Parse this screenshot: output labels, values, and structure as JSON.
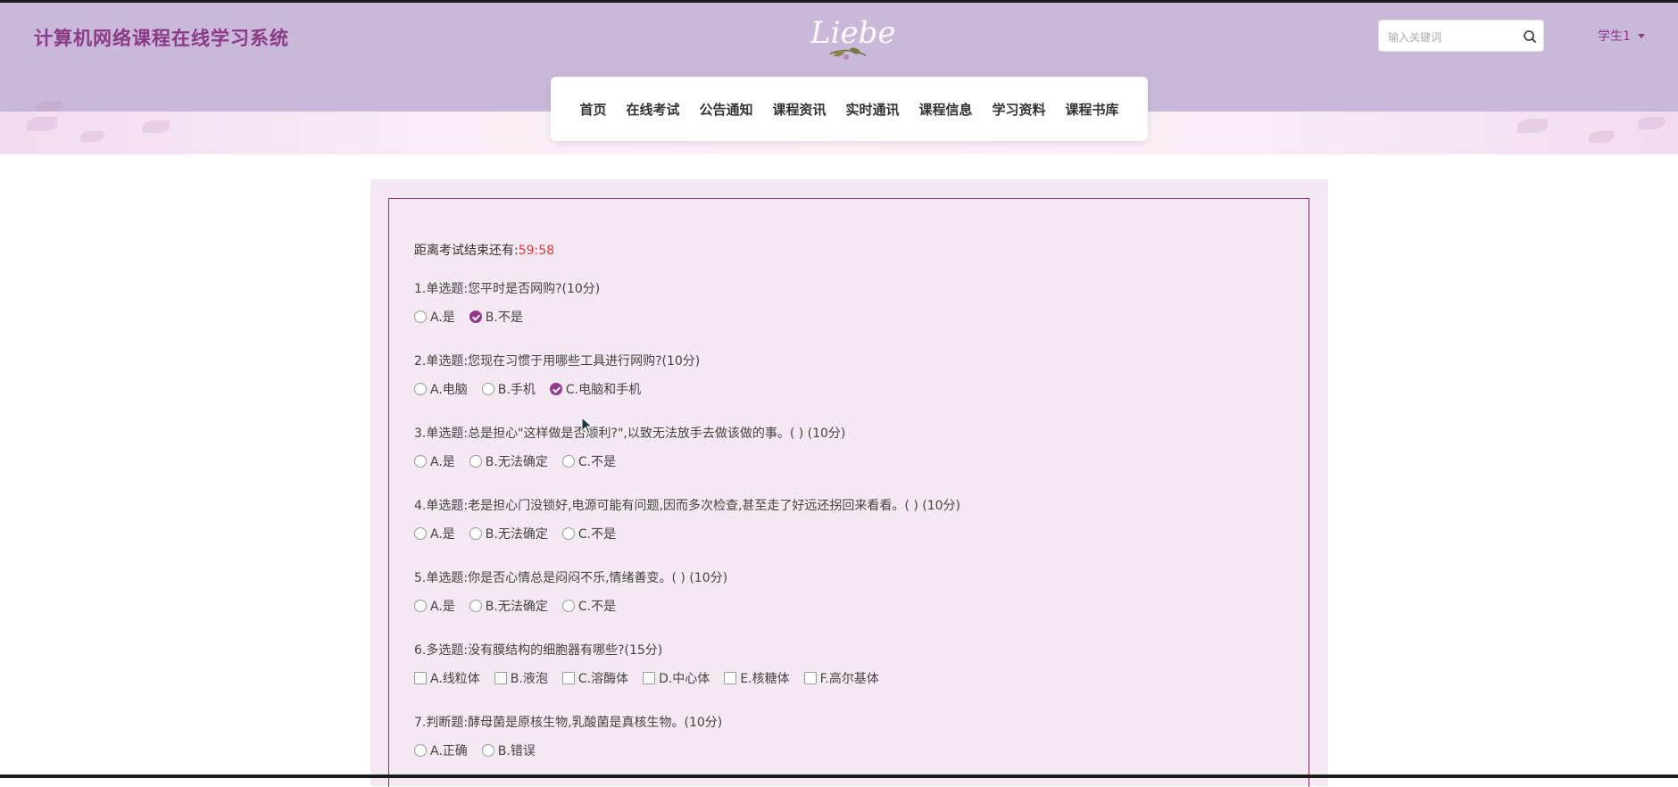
{
  "header": {
    "site_title": "计算机网络课程在线学习系统",
    "logo_text": "Liebe",
    "search_placeholder": "输入关键词",
    "user_label": "学生1",
    "accent_color": "#8a3a86",
    "header_bg": "#c9b8d9"
  },
  "nav": {
    "items": [
      "首页",
      "在线考试",
      "公告通知",
      "课程资讯",
      "实时通讯",
      "课程信息",
      "学习资料",
      "课程书库"
    ]
  },
  "exam": {
    "timer_label": "距离考试结束还有:",
    "timer_value": "59:58",
    "questions": [
      {
        "title": "1.单选题:您平时是否网购?(10分)",
        "type": "radio",
        "options": [
          {
            "label": "A.是",
            "checked": false
          },
          {
            "label": "B.不是",
            "checked": true
          }
        ]
      },
      {
        "title": "2.单选题:您现在习惯于用哪些工具进行网购?(10分)",
        "type": "radio",
        "options": [
          {
            "label": "A.电脑",
            "checked": false
          },
          {
            "label": "B.手机",
            "checked": false
          },
          {
            "label": "C.电脑和手机",
            "checked": true
          }
        ]
      },
      {
        "title": "3.单选题:总是担心\"这样做是否顺利?\",以致无法放手去做该做的事。( ) (10分)",
        "type": "radio",
        "options": [
          {
            "label": "A.是",
            "checked": false
          },
          {
            "label": "B.无法确定",
            "checked": false
          },
          {
            "label": "C.不是",
            "checked": false
          }
        ]
      },
      {
        "title": "4.单选题:老是担心门没锁好,电源可能有问题,因而多次检查,甚至走了好远还拐回来看看。( ) (10分)",
        "type": "radio",
        "options": [
          {
            "label": "A.是",
            "checked": false
          },
          {
            "label": "B.无法确定",
            "checked": false
          },
          {
            "label": "C.不是",
            "checked": false
          }
        ]
      },
      {
        "title": "5.单选题:你是否心情总是闷闷不乐,情绪善变。( ) (10分)",
        "type": "radio",
        "options": [
          {
            "label": "A.是",
            "checked": false
          },
          {
            "label": "B.无法确定",
            "checked": false
          },
          {
            "label": "C.不是",
            "checked": false
          }
        ]
      },
      {
        "title": "6.多选题:没有膜结构的细胞器有哪些?(15分)",
        "type": "checkbox",
        "options": [
          {
            "label": "A.线粒体",
            "checked": false
          },
          {
            "label": "B.液泡",
            "checked": false
          },
          {
            "label": "C.溶酶体",
            "checked": false
          },
          {
            "label": "D.中心体",
            "checked": false
          },
          {
            "label": "E.核糖体",
            "checked": false
          },
          {
            "label": "F.高尔基体",
            "checked": false
          }
        ]
      },
      {
        "title": "7.判断题:酵母菌是原核生物,乳酸菌是真核生物。(10分)",
        "type": "radio",
        "options": [
          {
            "label": "A.正确",
            "checked": false
          },
          {
            "label": "B.错误",
            "checked": false
          }
        ]
      }
    ]
  }
}
